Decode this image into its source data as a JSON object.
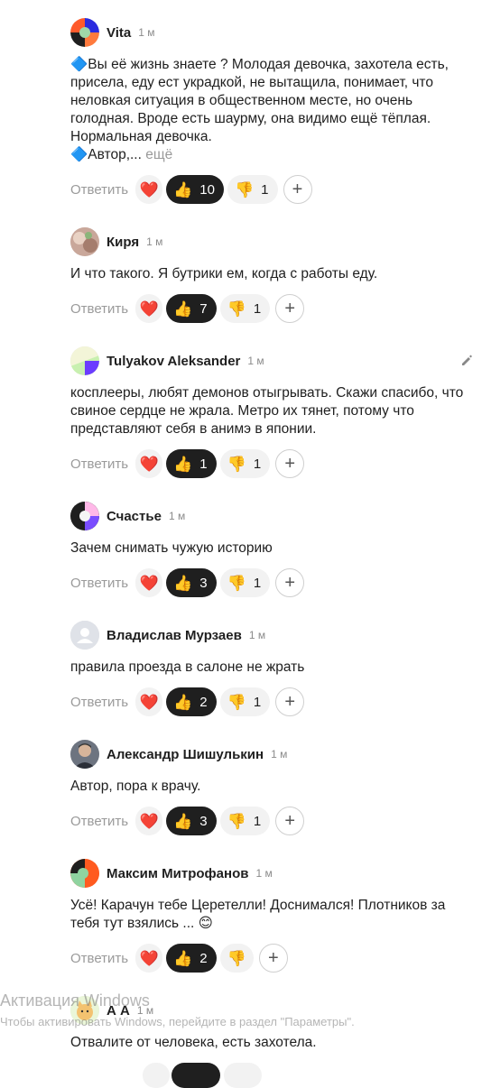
{
  "ui": {
    "reply_label": "Ответить",
    "more_label": "ещё",
    "react_emoji": "❤️",
    "like_emoji": "👍",
    "dislike_emoji": "👎",
    "add_label": "+"
  },
  "comments": [
    {
      "author": "Vita",
      "time": "1 м",
      "text_lines": [
        "🔷Вы её жизнь знаете ? Молодая девочка, захотела есть,",
        "присела, еду ест украдкой, не вытащила, понимает, что",
        "неловкая ситуация в общественном месте, но очень",
        "голодная. Вроде есть шаурму, она видимо ещё тёплая.",
        "Нормальная девочка."
      ],
      "text_tail": "🔷Автор,...",
      "likes": "10",
      "dislikes": "1",
      "like_active": true
    },
    {
      "author": "Киря",
      "time": "1 м",
      "text_lines": [
        "И что такого. Я бутрики ем, когда с работы еду."
      ],
      "likes": "7",
      "dislikes": "1",
      "like_active": true
    },
    {
      "author": "Tulyakov Aleksander",
      "time": "1 м",
      "text_lines": [
        "косплееры, любят демонов отыгрывать. Скажи спасибо, что",
        "свиное сердце не жрала. Метро их тянет, потому что",
        "представляют себя в анимэ в японии."
      ],
      "likes": "1",
      "dislikes": "1",
      "like_active": true
    },
    {
      "author": "Счастье",
      "time": "1 м",
      "text_lines": [
        "Зачем снимать чужую историю"
      ],
      "likes": "3",
      "dislikes": "1",
      "like_active": true
    },
    {
      "author": "Владислав Мурзаев",
      "time": "1 м",
      "text_lines": [
        "правила проезда в салоне не жрать"
      ],
      "likes": "2",
      "dislikes": "1",
      "like_active": true
    },
    {
      "author": "Александр Шишулькин",
      "time": "1 м",
      "text_lines": [
        "Автор, пора к врачу."
      ],
      "likes": "3",
      "dislikes": "1",
      "like_active": true
    },
    {
      "author": "Максим Митрофанов",
      "time": "1 м",
      "text_lines": [
        "Усё! Карачун тебе Церетелли! Доснимался! Плотников за",
        "тебя тут взялись ... 😊"
      ],
      "likes": "2",
      "dislikes": "",
      "like_active": true
    },
    {
      "author": "А А",
      "time": "1 м",
      "text_lines": [
        "Отвалите от человека, есть захотела."
      ]
    }
  ],
  "watermark": {
    "title": "Активация Windows",
    "subtitle": "Чтобы активировать Windows, перейдите в раздел \"Параметры\"."
  }
}
